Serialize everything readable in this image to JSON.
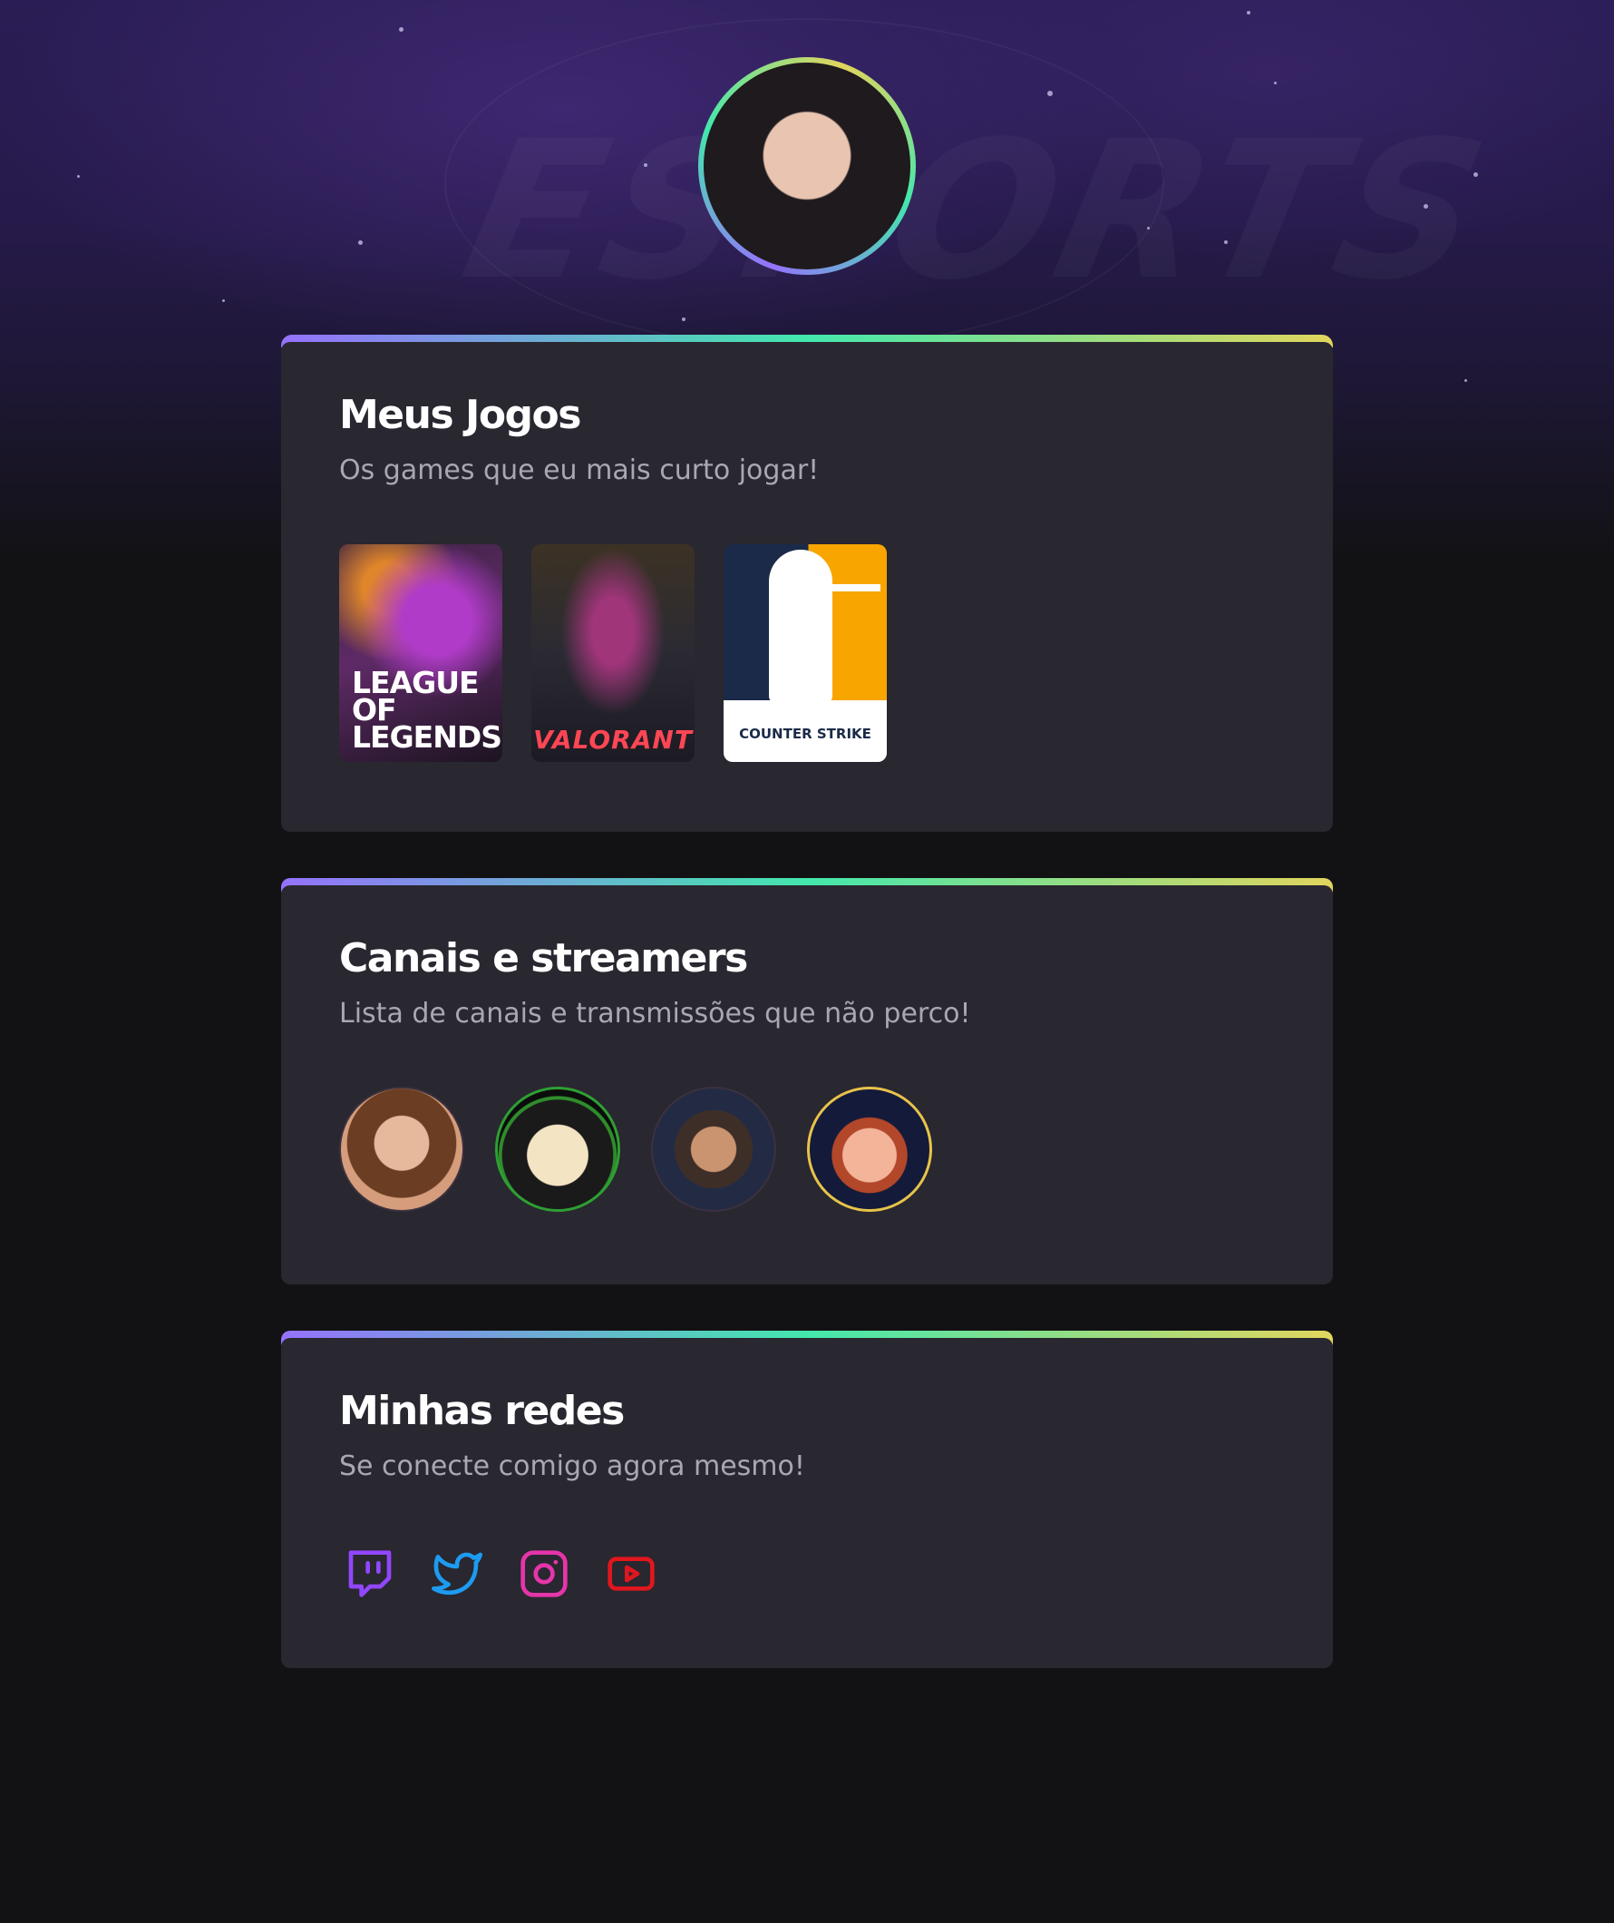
{
  "profile": {
    "avatar_alt": "Foto de perfil"
  },
  "sections": {
    "games": {
      "title": "Meus Jogos",
      "subtitle": "Os games que eu mais curto jogar!",
      "items": [
        {
          "name": "League of Legends",
          "logo_line1": "LEAGUE OF",
          "logo_line2": "LEGENDS"
        },
        {
          "name": "Valorant",
          "logo": "VALORANT"
        },
        {
          "name": "Counter-Strike",
          "logo": "COUNTER STRIKE"
        }
      ]
    },
    "streamers": {
      "title": "Canais e streamers",
      "subtitle": "Lista de canais e transmissões que não perco!"
    },
    "social": {
      "title": "Minhas redes",
      "subtitle": "Se conecte comigo agora mesmo!",
      "icons": [
        "twitch-icon",
        "twitter-icon",
        "instagram-icon",
        "youtube-icon"
      ]
    }
  },
  "colors": {
    "background": "#121214",
    "card": "#29272f",
    "gradient": [
      "#9572fc",
      "#43e7ad",
      "#e1d55d"
    ],
    "twitch": "#9147ff",
    "twitter": "#1d9bf0",
    "instagram": "#e535ab",
    "youtube": "#e0161e"
  }
}
